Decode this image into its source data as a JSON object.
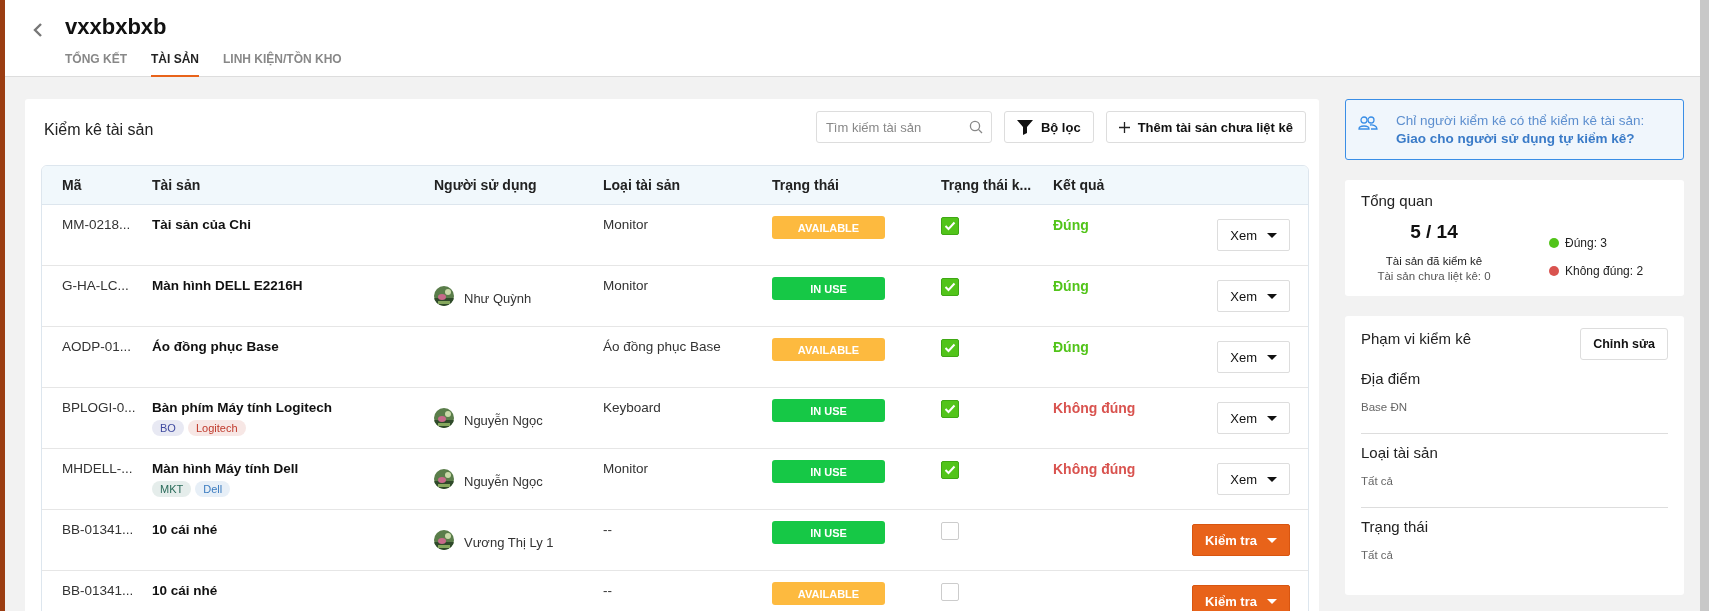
{
  "header": {
    "title": "vxxbxbxb"
  },
  "tabs": [
    {
      "label": "TỔNG KẾT",
      "selected": false
    },
    {
      "label": "TÀI SẢN",
      "selected": true
    },
    {
      "label": "LINH KIỆN/TỒN KHO",
      "selected": false
    }
  ],
  "inventory": {
    "title": "Kiểm kê tài sản",
    "search": {
      "placeholder": "Tìm kiếm tài sản"
    },
    "filter_button": "Bộ lọc",
    "add_button": "Thêm tài sản chưa liệt kê"
  },
  "table": {
    "columns": [
      "Mã",
      "Tài sản",
      "Người sử dụng",
      "Loại tài sản",
      "Trạng thái",
      "Trạng thái k...",
      "Kết quả"
    ],
    "rows": [
      {
        "code": "MM-0218...",
        "asset": "Tài sản của Chi",
        "type": "Monitor",
        "status": {
          "label": "AVAILABLE",
          "kind": "available"
        },
        "checked": true,
        "result": {
          "label": "Đúng",
          "kind": "correct"
        },
        "action": {
          "label": "Xem",
          "kind": "view"
        }
      },
      {
        "code": "G-HA-LC...",
        "asset": "Màn hình DELL E2216H",
        "user": "Như Quỳnh",
        "type": "Monitor",
        "status": {
          "label": "IN USE",
          "kind": "in_use"
        },
        "checked": true,
        "result": {
          "label": "Đúng",
          "kind": "correct"
        },
        "action": {
          "label": "Xem",
          "kind": "view"
        }
      },
      {
        "code": "AODP-01...",
        "asset": "Áo đồng phục Base",
        "type": "Áo đồng phục Base",
        "status": {
          "label": "AVAILABLE",
          "kind": "available"
        },
        "checked": true,
        "result": {
          "label": "Đúng",
          "kind": "correct"
        },
        "action": {
          "label": "Xem",
          "kind": "view"
        }
      },
      {
        "code": "BPLOGI-0...",
        "asset": "Bàn phím Máy tính Logitech",
        "tags": [
          {
            "label": "BO",
            "color": "#3f4aa0"
          },
          {
            "label": "Logitech",
            "color": "#c0392b"
          }
        ],
        "user": "Nguyễn Ngọc",
        "type": "Keyboard",
        "status": {
          "label": "IN USE",
          "kind": "in_use"
        },
        "checked": true,
        "result": {
          "label": "Không đúng",
          "kind": "incorrect"
        },
        "action": {
          "label": "Xem",
          "kind": "view"
        }
      },
      {
        "code": "MHDELL-...",
        "asset": "Màn hình Máy tính Dell",
        "tags": [
          {
            "label": "MKT",
            "color": "#2a6b5a"
          },
          {
            "label": "Dell",
            "color": "#3a7bc0"
          }
        ],
        "user": "Nguyễn Ngọc",
        "type": "Monitor",
        "status": {
          "label": "IN USE",
          "kind": "in_use"
        },
        "checked": true,
        "result": {
          "label": "Không đúng",
          "kind": "incorrect"
        },
        "action": {
          "label": "Xem",
          "kind": "view"
        }
      },
      {
        "code": "BB-01341...",
        "asset": "10 cái nhé",
        "user": "Vương Thị Ly 1",
        "type": "--",
        "status": {
          "label": "IN USE",
          "kind": "in_use"
        },
        "checked": false,
        "action": {
          "label": "Kiểm tra",
          "kind": "check"
        }
      },
      {
        "code": "BB-01341...",
        "asset": "10 cái nhé",
        "type": "--",
        "status": {
          "label": "AVAILABLE",
          "kind": "available"
        },
        "checked": false,
        "action": {
          "label": "Kiểm tra",
          "kind": "check"
        }
      }
    ]
  },
  "notice": {
    "text": "Chỉ người kiểm kê có thể kiểm kê tài sản:",
    "link": "Giao cho người sử dụng tự kiểm kê?"
  },
  "overview": {
    "title": "Tổng quan",
    "count": "5 / 14",
    "count_label": "Tài sản đã kiểm kê",
    "unlisted": "Tài sản chưa liệt kê: 0",
    "legend": [
      {
        "label": "Đúng: 3",
        "color": "#52c41a"
      },
      {
        "label": "Không đúng: 2",
        "color": "#d9534f"
      }
    ]
  },
  "scope": {
    "title": "Phạm vi kiểm kê",
    "edit_button": "Chỉnh sửa",
    "sections": [
      {
        "label": "Địa điểm",
        "value": "Base ĐN"
      },
      {
        "label": "Loại tài sản",
        "value": "Tất cả"
      },
      {
        "label": "Trạng thái",
        "value": "Tất cả"
      }
    ]
  }
}
